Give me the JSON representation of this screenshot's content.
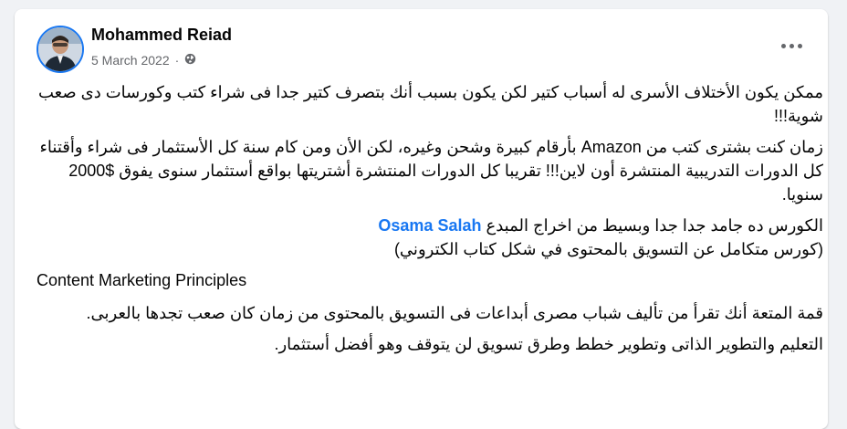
{
  "post": {
    "author": "Mohammed Reiad",
    "date": "5 March 2022",
    "date_separator": "·",
    "privacy_icon": "globe-icon",
    "more_icon": "more-options-icon",
    "paragraphs": {
      "p1": "ممكن يكون الأختلاف الأسرى له أسباب كتير لكن يكون بسبب أنك بتصرف كتير جدا فى شراء كتب وكورسات دى صعب شوية!!!",
      "p2": "زمان كنت بشترى كتب من Amazon بأرقام كبيرة وشحن وغيره، لكن الأن ومن كام سنة كل الأستثمار فى شراء وأقتناء كل الدورات التدريبية المنتشرة أون لاين!!! تقريبا كل الدورات المنتشرة أشتريتها بواقع أستثمار سنوى يفوق $2000 سنويا.",
      "p3_text": "الكورس ده جامد جدا جدا وبسيط من اخراج المبدع",
      "p3_link": "Osama Salah",
      "p4": "(كورس متكامل عن التسويق بالمحتوى في شكل كتاب الكتروني)",
      "p5": "Content Marketing Principles",
      "p6": "قمة المتعة أنك تقرأ من تأليف شباب مصرى أبداعات فى التسويق بالمحتوى من زمان كان صعب تجدها بالعربى.",
      "p7": "التعليم والتطوير الذاتى وتطوير خطط وطرق تسويق لن يتوقف وهو أفضل أستثمار."
    }
  }
}
